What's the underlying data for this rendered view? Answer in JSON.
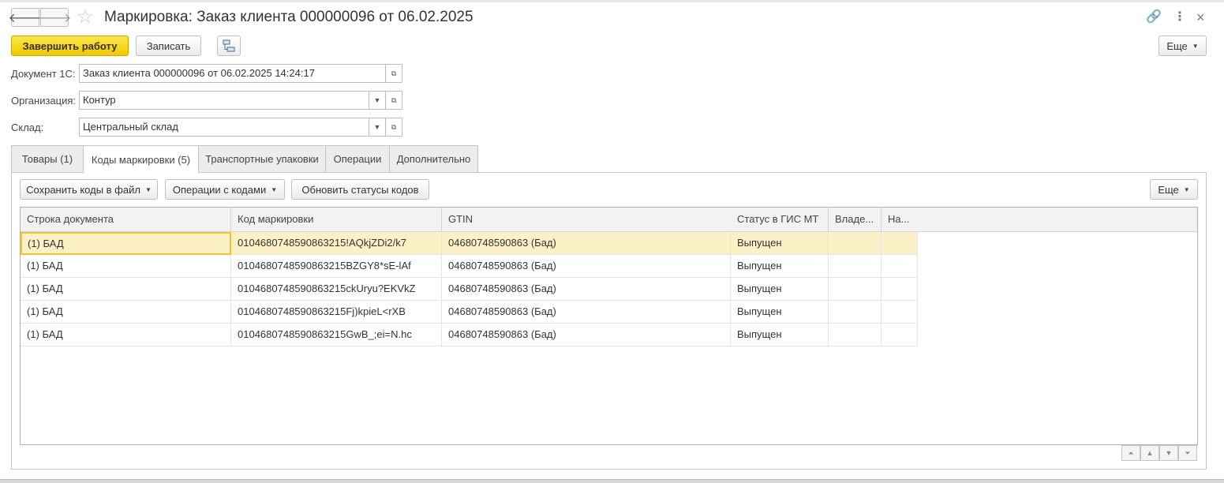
{
  "window": {
    "title": "Маркировка: Заказ клиента 000000096 от 06.02.2025",
    "nav_back": "🡐",
    "nav_forward": "🡒",
    "star": "☆",
    "link_icon": "🔗",
    "more_icon": "⋮",
    "close_icon": "×"
  },
  "toolbar": {
    "finish_label": "Завершить работу",
    "save_label": "Записать",
    "more_label": "Еще"
  },
  "form": {
    "document_label": "Документ 1С:",
    "document_value": "Заказ клиента 000000096 от 06.02.2025 14:24:17",
    "organization_label": "Организация:",
    "organization_value": "Контур",
    "warehouse_label": "Склад:",
    "warehouse_value": "Центральный склад"
  },
  "tabs": [
    {
      "label": "Товары (1)"
    },
    {
      "label": "Коды маркировки (5)"
    },
    {
      "label": "Транспортные упаковки"
    },
    {
      "label": "Операции"
    },
    {
      "label": "Дополнительно"
    }
  ],
  "panel_toolbar": {
    "save_codes_label": "Сохранить коды в файл",
    "code_ops_label": "Операции с кодами",
    "refresh_label": "Обновить статусы кодов",
    "more_label": "Еще"
  },
  "table": {
    "columns": [
      "Строка документа",
      "Код маркировки",
      "GTIN",
      "Статус в ГИС МТ",
      "Владе...",
      "На..."
    ],
    "rows": [
      [
        "(1) БАД",
        "0104680748590863215!AQkjZDi2/k7",
        "04680748590863 (Бад)",
        "Выпущен",
        "",
        ""
      ],
      [
        "(1) БАД",
        "0104680748590863215BZGY8*sE-lAf",
        "04680748590863 (Бад)",
        "Выпущен",
        "",
        ""
      ],
      [
        "(1) БАД",
        "0104680748590863215ckUryu?EKVkZ",
        "04680748590863 (Бад)",
        "Выпущен",
        "",
        ""
      ],
      [
        "(1) БАД",
        "0104680748590863215Fj)kpieL<rXB",
        "04680748590863 (Бад)",
        "Выпущен",
        "",
        ""
      ],
      [
        "(1) БАД",
        "0104680748590863215GwB_;ei=N.hc",
        "04680748590863 (Бад)",
        "Выпущен",
        "",
        ""
      ]
    ]
  },
  "colors": {
    "accent_yellow": "#f5d20e",
    "selected_row": "#fbf0c6",
    "focus_border": "#f1c232"
  }
}
